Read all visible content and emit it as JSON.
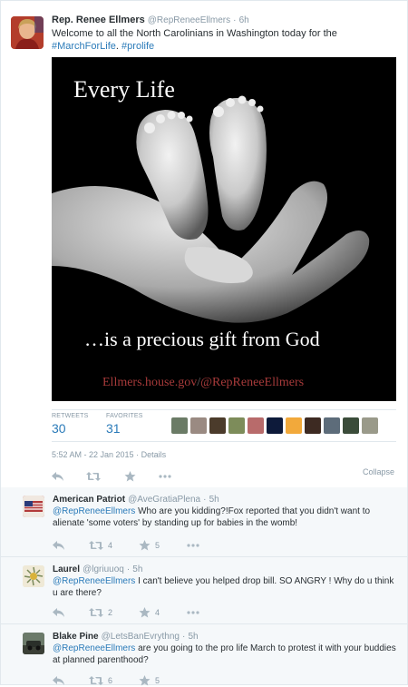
{
  "main_tweet": {
    "author_name": "Rep. Renee Ellmers",
    "author_handle": "@RepReneeEllmers",
    "separator": "·",
    "time": "6h",
    "text_prefix": "Welcome to all the North Carolinians in Washington today for the ",
    "hashtag1": "#MarchForLife",
    "text_mid": ".",
    "hashtag2": "#prolife",
    "image": {
      "headline": "Every Life",
      "tagline": "…is a precious gift from God",
      "footer_site": "Ellmers.house.gov",
      "footer_slash": "/",
      "footer_handle": "@RepReneeEllmers"
    },
    "stats": {
      "retweets_label": "RETWEETS",
      "retweets_value": "30",
      "favorites_label": "FAVORITES",
      "favorites_value": "31"
    },
    "favoriter_avatars": [
      {
        "icon": "person-photo-avatar",
        "color": "#6b7b66"
      },
      {
        "icon": "person-photo-avatar",
        "color": "#9a8a82"
      },
      {
        "icon": "dark-photo-avatar",
        "color": "#4b3b2b"
      },
      {
        "icon": "photo-avatar",
        "color": "#7d8c5a"
      },
      {
        "icon": "flag-avatar",
        "color": "#b86b6b"
      },
      {
        "icon": "blue-line-avatar",
        "color": "#0d1a3a"
      },
      {
        "icon": "orange-avatar",
        "color": "#f2a93b"
      },
      {
        "icon": "dark-photo-avatar",
        "color": "#3d2a22"
      },
      {
        "icon": "photo-avatar",
        "color": "#5d6c7a"
      },
      {
        "icon": "landscape-avatar",
        "color": "#3b4c3a"
      },
      {
        "icon": "animal-avatar",
        "color": "#9a9a8a"
      }
    ],
    "timestamp": "5:52 AM - 22 Jan 2015",
    "details_link": "Details",
    "collapse": "Collapse"
  },
  "replies": [
    {
      "author_name": "American Patriot",
      "author_handle": "@AveGratiaPlena",
      "separator": "·",
      "time": "5h",
      "mention": "@RepReneeEllmers",
      "text": "  Who are you kidding?!Fox reported that you didn't want to alienate 'some voters' by standing up for babies in the womb!",
      "retweets": "4",
      "favorites": "5",
      "avatar_color": "#b23a3a"
    },
    {
      "author_name": "Laurel",
      "author_handle": "@lgriuuoq",
      "separator": "·",
      "time": "5h",
      "mention": "@RepReneeEllmers",
      "text": " I can't believe you helped drop bill. SO ANGRY ! Why do u think u are there?",
      "retweets": "2",
      "favorites": "4",
      "avatar_color": "#e9e1c8"
    },
    {
      "author_name": "Blake Pine",
      "author_handle": "@LetsBanEvrythng",
      "separator": "·",
      "time": "5h",
      "mention": "@RepReneeEllmers",
      "text": " are you going to the pro life March to protest it with your buddies at planned parenthood?",
      "retweets": "6",
      "favorites": "5",
      "avatar_color": "#4c5a4a"
    }
  ],
  "icons": {
    "reply": "reply-arrow-icon",
    "retweet": "retweet-icon",
    "favorite": "star-icon",
    "more": "more-dots-icon"
  },
  "colors": {
    "link": "#2b7bb9",
    "muted": "#8899a6",
    "action": "#aab8c2",
    "image_text_red": "#a63a3a"
  }
}
